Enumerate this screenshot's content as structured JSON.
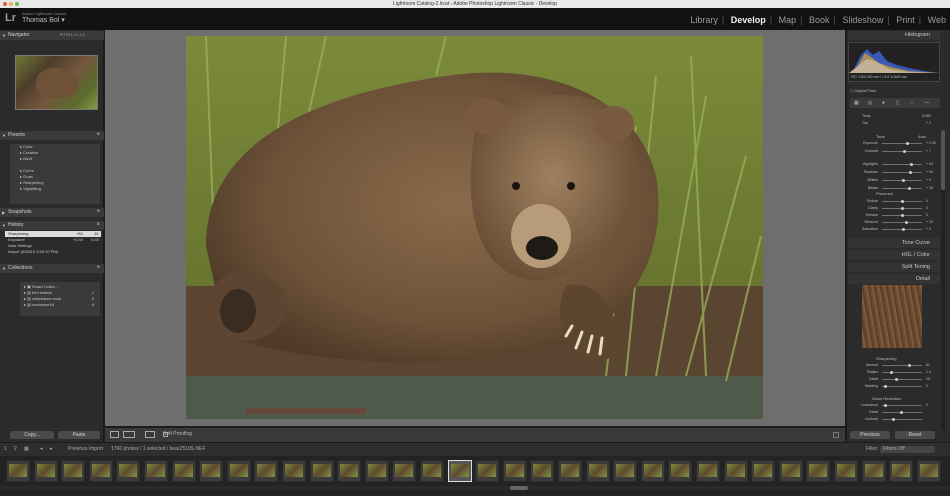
{
  "window": {
    "title": "Lightroom Catalog-2.lrcat - Adobe Photoshop Lightroom Classic - Develop"
  },
  "identity": {
    "logo": "Lr",
    "app": "Adobe Lightroom Classic",
    "user": "Thomas Bol"
  },
  "modules": [
    "Library",
    "Develop",
    "Map",
    "Book",
    "Slideshow",
    "Print",
    "Web"
  ],
  "left_panel": {
    "navigator": {
      "title": "Navigator",
      "zoom": [
        "FIT",
        "FILL",
        "1:1",
        "1:3"
      ]
    },
    "presets": {
      "title": "Presets",
      "items": [
        "Color",
        "Creative",
        "B&W",
        "Curve",
        "Grain",
        "Sharpening",
        "Vignetting"
      ]
    },
    "snapshots": {
      "title": "Snapshots"
    },
    "history": {
      "title": "History",
      "items": [
        {
          "label": "Sharpening",
          "v1": "+61",
          "v2": "61"
        },
        {
          "label": "Exposure",
          "v1": "+0.40",
          "v2": "0.40"
        },
        {
          "label": "Auto Settings",
          "v1": "",
          "v2": ""
        },
        {
          "label": "Import (8/26/19 3:00:10 PM)",
          "v1": "",
          "v2": ""
        }
      ]
    },
    "collections": {
      "title": "Collections",
      "items": [
        {
          "label": "Smart Collec...",
          "count": ""
        },
        {
          "label": "bird selects",
          "count": "1"
        },
        {
          "label": "wildchaism work",
          "count": "5"
        },
        {
          "label": "zoobeyne18",
          "count": "8"
        }
      ]
    },
    "copy_label": "Copy...",
    "paste_label": "Paste"
  },
  "toolbar": {
    "soft_proofing": "Soft Proofing"
  },
  "right_panel": {
    "histogram": {
      "title": "Histogram",
      "iso": "ISO 1250",
      "focal": "300 mm",
      "aperture": "f / 5.6",
      "shutter": "1/1600 sec",
      "original_photo": "Original Photo"
    },
    "basic": {
      "wb": [
        "Temp",
        "Tint"
      ],
      "wb_values": [
        "5,050",
        "+ 2"
      ],
      "tone_label": "Tone",
      "auto_label": "Auto",
      "tone": [
        {
          "label": "Exposure",
          "value": "+ 0.40"
        },
        {
          "label": "Contrast",
          "value": "+ 7"
        },
        {
          "label": "Highlights",
          "value": "+ 63"
        },
        {
          "label": "Shadows",
          "value": "+ 50"
        },
        {
          "label": "Whites",
          "value": "+ 5"
        },
        {
          "label": "Blacks",
          "value": "+ 18"
        }
      ],
      "presence_label": "Presence",
      "presence": [
        {
          "label": "Texture",
          "value": "0"
        },
        {
          "label": "Clarity",
          "value": "0"
        },
        {
          "label": "Dehaze",
          "value": "0"
        },
        {
          "label": "Vibrance",
          "value": "+ 15"
        },
        {
          "label": "Saturation",
          "value": "+ 4"
        }
      ]
    },
    "sections": [
      "Tone Curve",
      "HSL / Color",
      "Split Toning",
      "Detail"
    ],
    "sharpening": {
      "title": "Sharpening",
      "items": [
        {
          "label": "Amount",
          "value": "61"
        },
        {
          "label": "Radius",
          "value": "1.0"
        },
        {
          "label": "Detail",
          "value": "25"
        },
        {
          "label": "Masking",
          "value": "0"
        }
      ]
    },
    "noise_reduction": {
      "title": "Noise Reduction",
      "items": [
        {
          "label": "Luminance",
          "value": "0"
        },
        {
          "label": "Detail",
          "value": ""
        },
        {
          "label": "Contrast",
          "value": ""
        }
      ]
    },
    "previous_label": "Previous",
    "reset_label": "Reset"
  },
  "filmstrip": {
    "source": "Previous Import",
    "info": "1760 photos / 1 selected / bear2519S.NEF",
    "filter_label": "Filter:",
    "filter_value": "Filters Off",
    "page_1": "1",
    "page_2": "2"
  }
}
